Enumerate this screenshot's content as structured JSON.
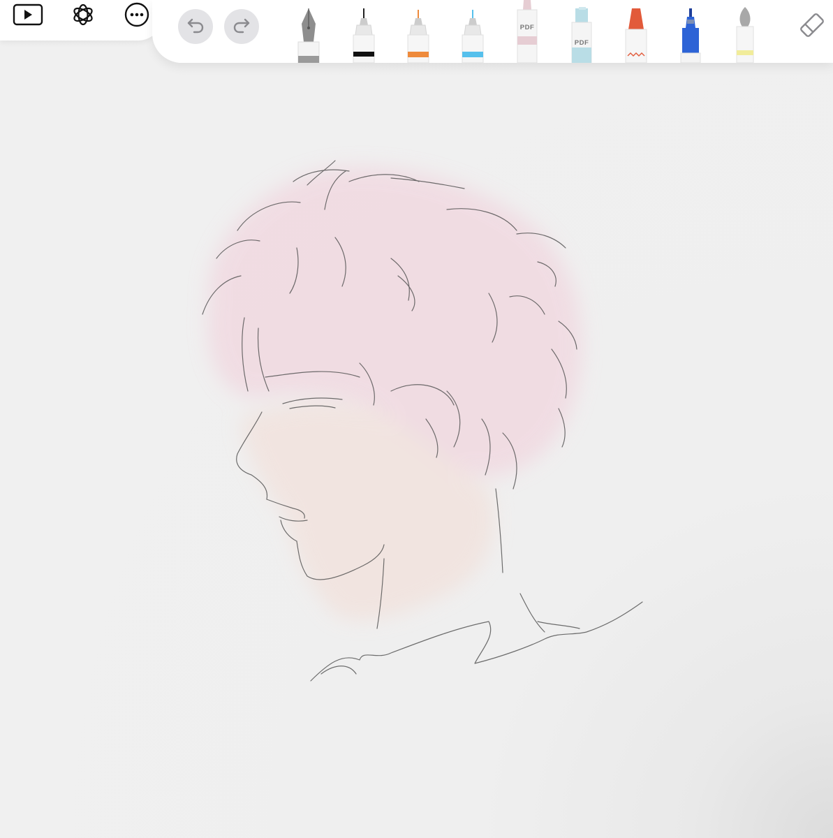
{
  "left_panel": {
    "buttons": [
      {
        "icon": "play-icon"
      },
      {
        "icon": "openai-logo-icon"
      },
      {
        "icon": "more-options-icon"
      }
    ]
  },
  "toolbar": {
    "undo_icon": "undo-icon",
    "redo_icon": "redo-icon",
    "tools": [
      {
        "name": "fountain-pen",
        "color": "#9a9a9a"
      },
      {
        "name": "fineliner-black",
        "color": "#111111"
      },
      {
        "name": "fineliner-orange",
        "color": "#ee8a3c"
      },
      {
        "name": "fineliner-blue",
        "color": "#56c0ec"
      },
      {
        "name": "marker-pink",
        "color": "#e6cdd3",
        "label": "PDF"
      },
      {
        "name": "highlighter-blue",
        "color": "#b9dde6",
        "label": "PDF"
      },
      {
        "name": "crayon-red",
        "color": "#e25a3a"
      },
      {
        "name": "pen-blue",
        "color": "#2d63d6"
      },
      {
        "name": "watercolor-brush",
        "color": "#f1ec9a"
      }
    ],
    "eraser_icon": "eraser-icon"
  },
  "canvas": {
    "background": "#efefef"
  }
}
